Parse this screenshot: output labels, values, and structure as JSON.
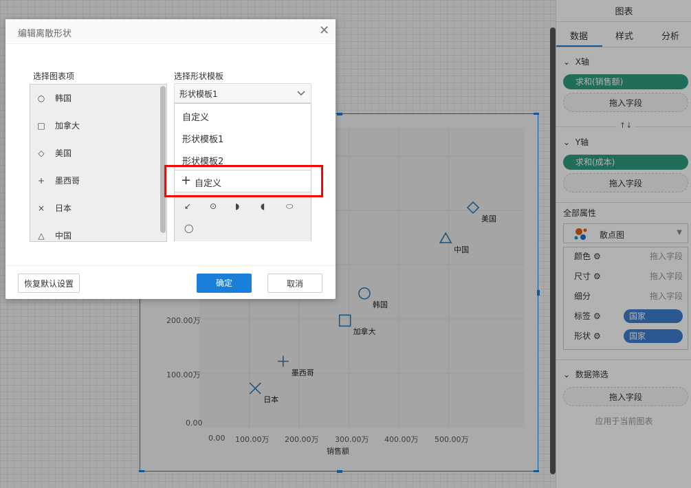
{
  "colors": {
    "accent": "#1a7fd9",
    "pill_green": "#2e9c80",
    "pill_blue": "#3f7fd0",
    "highlight": "#ff0000",
    "marker": "#2b7cb8"
  },
  "chart": {
    "y_ticks": [
      "200.00万",
      "100.00万",
      "0.00"
    ],
    "x_ticks": [
      "0.00",
      "100.00万",
      "200.00万",
      "300.00万",
      "400.00万",
      "500.00万"
    ],
    "x_label": "销售额"
  },
  "chart_data": {
    "type": "scatter",
    "xlabel": "销售额",
    "ylabel": "",
    "x_ticks": [
      "0.00",
      "100.00万",
      "200.00万",
      "300.00万",
      "400.00万",
      "500.00万"
    ],
    "y_ticks_visible": [
      "0.00",
      "100.00万",
      "200.00万"
    ],
    "xlim": [
      0,
      652
    ],
    "ylim": [
      0,
      552
    ],
    "units": "万",
    "grid": true,
    "points": [
      {
        "label": "日本",
        "shape": "cross",
        "x": 112,
        "y": 72
      },
      {
        "label": "墨西哥",
        "shape": "plus",
        "x": 168,
        "y": 122
      },
      {
        "label": "加拿大",
        "shape": "square",
        "x": 292,
        "y": 197
      },
      {
        "label": "韩国",
        "shape": "circle",
        "x": 331,
        "y": 247
      },
      {
        "label": "中国",
        "shape": "triangle",
        "x": 494,
        "y": 348
      },
      {
        "label": "美国",
        "shape": "diamond",
        "x": 549,
        "y": 405
      }
    ]
  },
  "panel": {
    "title": "图表",
    "tabs": [
      "数据",
      "样式",
      "分析"
    ],
    "x_axis": "X轴",
    "x_field": "求和(销售额)",
    "drop": "拖入字段",
    "swap_icon": "↑↓",
    "y_axis": "Y轴",
    "y_field": "求和(成本)",
    "all_props": "全部属性",
    "chart_type": "散点图",
    "props": [
      {
        "label": "颜色",
        "value": "拖入字段"
      },
      {
        "label": "尺寸",
        "value": "拖入字段"
      },
      {
        "label": "细分",
        "value": "拖入字段"
      },
      {
        "label": "标签",
        "value": "国家"
      },
      {
        "label": "形状",
        "value": "国家"
      }
    ],
    "filter": "数据筛选",
    "apply": "应用于当前图表"
  },
  "dialog": {
    "title": "编辑离散形状",
    "left_label": "选择图表项",
    "right_label": "选择形状模板",
    "items": [
      {
        "icon": "○",
        "name": "韩国"
      },
      {
        "icon": "□",
        "name": "加拿大"
      },
      {
        "icon": "◇",
        "name": "美国"
      },
      {
        "icon": "+",
        "name": "墨西哥"
      },
      {
        "icon": "×",
        "name": "日本"
      },
      {
        "icon": "△",
        "name": "中国"
      }
    ],
    "select_value": "形状模板1",
    "options": [
      "自定义",
      "形状模板1",
      "形状模板2"
    ],
    "add_custom": "自定义",
    "shapes": [
      "↙",
      "⊙",
      "◗",
      "◖",
      "⬭",
      "◯"
    ],
    "reset": "恢复默认设置",
    "ok": "确定",
    "cancel": "取消"
  }
}
